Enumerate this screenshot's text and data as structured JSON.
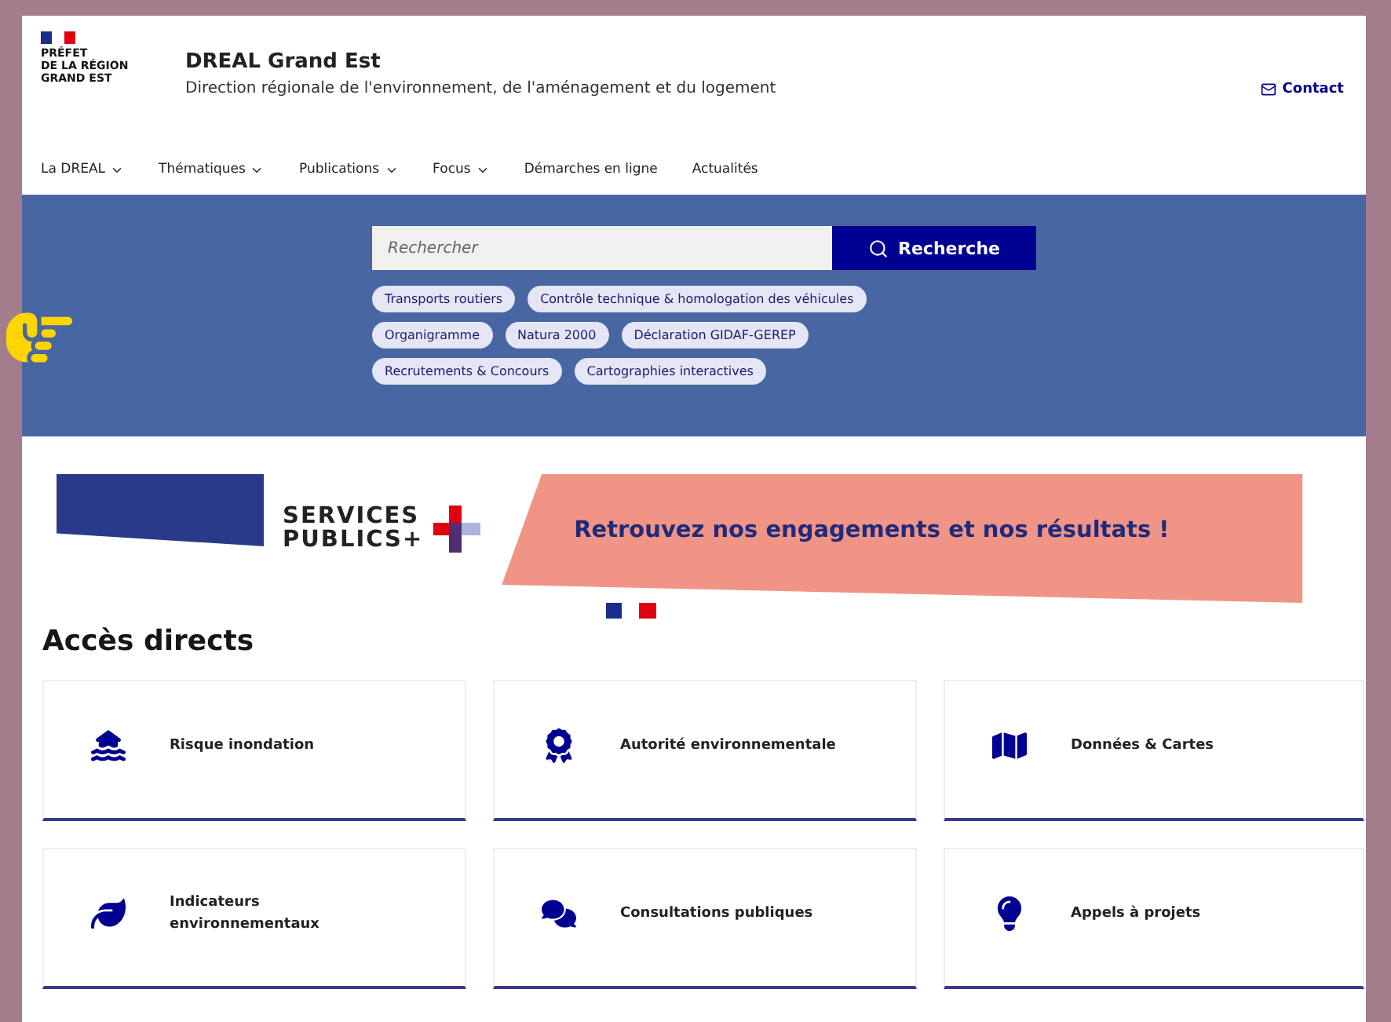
{
  "logo": {
    "lines": [
      "PRÉFET",
      "DE LA RÉGION",
      "GRAND EST"
    ]
  },
  "site": {
    "title": "DREAL Grand Est",
    "subtitle": "Direction régionale de l'environnement, de l'aménagement et du logement"
  },
  "contact": "Contact",
  "nav": [
    {
      "label": "La DREAL",
      "has_menu": true
    },
    {
      "label": "Thématiques",
      "has_menu": true
    },
    {
      "label": "Publications",
      "has_menu": true
    },
    {
      "label": "Focus",
      "has_menu": true
    },
    {
      "label": "Démarches en ligne",
      "has_menu": false
    },
    {
      "label": "Actualités",
      "has_menu": false
    }
  ],
  "search": {
    "placeholder": "Rechercher",
    "button": "Recherche"
  },
  "quick_links": [
    [
      "Transports routiers",
      "Contrôle technique & homologation des véhicules"
    ],
    [
      "Organigramme",
      "Natura 2000",
      "Déclaration GIDAF-GEREP"
    ],
    [
      "Recrutements & Concours",
      "Cartographies interactives"
    ]
  ],
  "banner": {
    "logo_lines": [
      "SERVICES",
      "PUBLICS+"
    ],
    "text": "Retrouvez nos engagements et nos résultats !"
  },
  "section_title": "Accès directs",
  "tiles": [
    {
      "kind": "flood",
      "label": "Risque inondation"
    },
    {
      "kind": "award",
      "label": "Autorité environnementale"
    },
    {
      "kind": "map",
      "label": "Données & Cartes"
    },
    {
      "kind": "leaf",
      "label": "Indicateurs environnementaux"
    },
    {
      "kind": "chat",
      "label": "Consultations publiques"
    },
    {
      "kind": "bulb",
      "label": "Appels à projets"
    }
  ]
}
